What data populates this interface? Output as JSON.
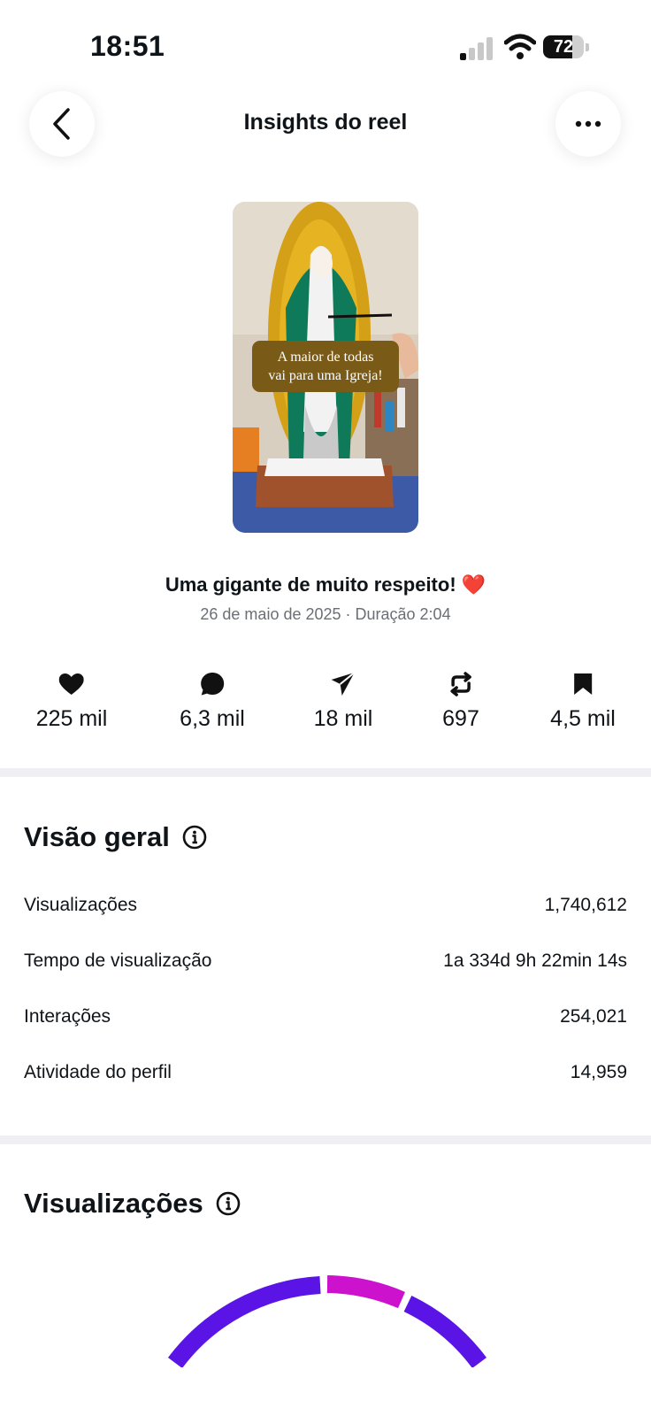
{
  "status_bar": {
    "time": "18:51",
    "battery": "72",
    "battery_level": 0.72,
    "icons": [
      "signal-icon",
      "wifi-icon",
      "battery-icon"
    ]
  },
  "header": {
    "title": "Insights do reel",
    "back_icon": "chevron-left-icon",
    "more_icon": "more-horizontal-icon"
  },
  "reel": {
    "thumbnail_caption_line1": "A maior de todas",
    "thumbnail_caption_line2": "vai para uma Igreja!",
    "title": "Uma gigante de muito respeito! ❤️",
    "meta": "26 de maio de 2025 · Duração 2:04"
  },
  "engagement": [
    {
      "icon": "heart-icon",
      "value": "225 mil"
    },
    {
      "icon": "comment-icon",
      "value": "6,3 mil"
    },
    {
      "icon": "share-icon",
      "value": "18 mil"
    },
    {
      "icon": "repost-icon",
      "value": "697"
    },
    {
      "icon": "bookmark-icon",
      "value": "4,5 mil"
    }
  ],
  "overview": {
    "title": "Visão geral",
    "rows": [
      {
        "label": "Visualizações",
        "value": "1,740,612"
      },
      {
        "label": "Tempo de visualização",
        "value": "1a 334d 9h 22min 14s"
      },
      {
        "label": "Interações",
        "value": "254,021"
      },
      {
        "label": "Atividade do perfil",
        "value": "14,959"
      }
    ]
  },
  "views_section": {
    "title": "Visualizações"
  },
  "colors": {
    "accent_purple": "#5b14e6",
    "accent_magenta": "#cc12cc",
    "divider": "#f0f0f4",
    "muted_text": "#6b6f74"
  }
}
